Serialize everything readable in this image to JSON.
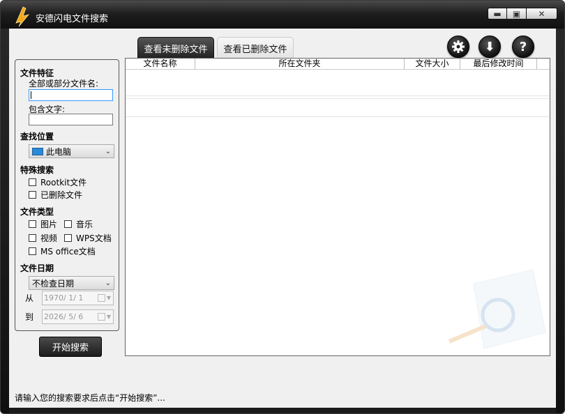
{
  "window": {
    "title": "安德闪电文件搜索",
    "controls": {
      "minimize": "▬",
      "maximize": "▣",
      "close": "✕"
    }
  },
  "tabs": [
    {
      "label": "查看未删除文件",
      "active": true
    },
    {
      "label": "查看已删除文件",
      "active": false
    }
  ],
  "toolbar": {
    "settings_icon": "gear-icon",
    "download_icon": "download-icon",
    "help_icon": "help-icon",
    "download_glyph": "⬇",
    "help_glyph": "?"
  },
  "file_features": {
    "heading": "文件特征",
    "name_label": "全部或部分文件名:",
    "name_value": "",
    "contains_label": "包含文字:",
    "contains_value": ""
  },
  "location": {
    "heading": "查找位置",
    "selected": "此电脑"
  },
  "special_search": {
    "heading": "特殊搜索",
    "options": [
      {
        "label": "Rootkit文件",
        "checked": false
      },
      {
        "label": "已删除文件",
        "checked": false
      }
    ]
  },
  "file_types": {
    "heading": "文件类型",
    "options": [
      {
        "label": "图片",
        "checked": false
      },
      {
        "label": "音乐",
        "checked": false
      },
      {
        "label": "视频",
        "checked": false
      },
      {
        "label": "WPS文档",
        "checked": false
      },
      {
        "label": "MS office文档",
        "checked": false
      }
    ]
  },
  "file_date": {
    "heading": "文件日期",
    "mode": "不检查日期",
    "from_label": "从",
    "from_value": "1970/ 1/ 1",
    "to_label": "到",
    "to_value": "2026/ 5/ 6"
  },
  "start_button": "开始搜索",
  "results": {
    "columns": [
      "文件名称",
      "所在文件夹",
      "文件大小",
      "最后修改时间"
    ],
    "rows": []
  },
  "status_text": "请输入您的搜索要求后点击“开始搜索”...",
  "colors": {
    "frame": "#1b1b1b",
    "client": "#f0f0f0",
    "accent_focus": "#3399ff"
  }
}
